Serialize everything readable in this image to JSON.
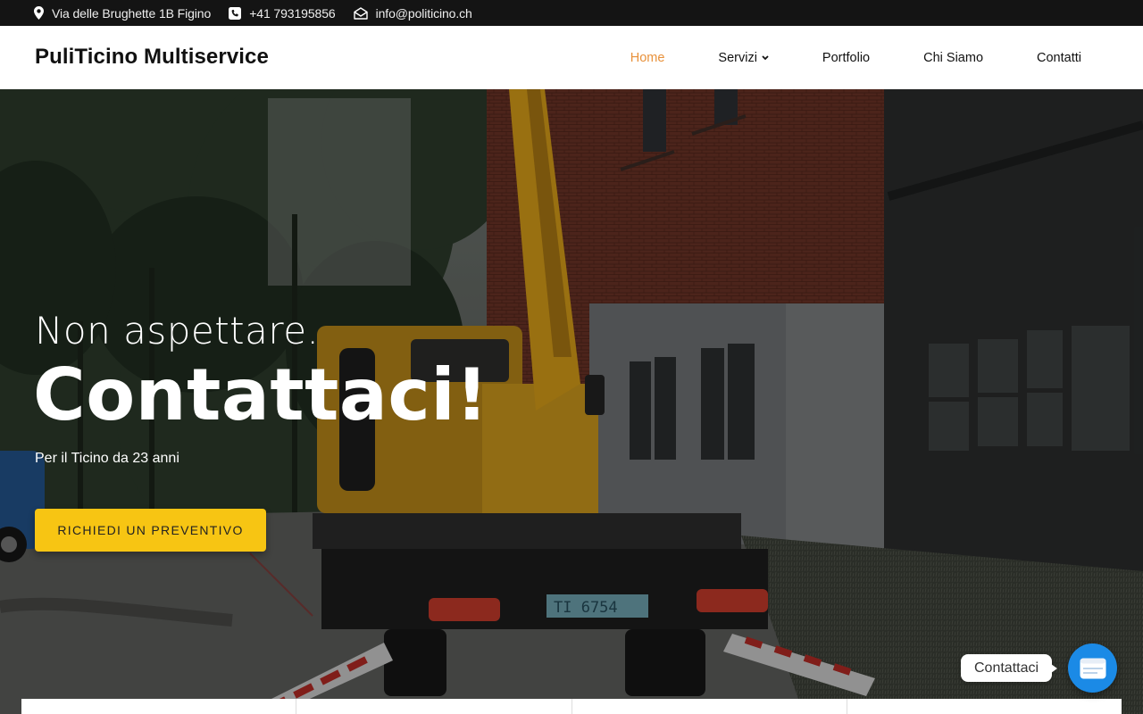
{
  "topbar": {
    "address": "Via delle Brughette 1B Figino",
    "phone": "+41 793195856",
    "email": "info@politicino.ch",
    "icons": [
      "map-pin-icon",
      "phone-icon",
      "envelope-icon"
    ]
  },
  "header": {
    "brand": "PuliTicino Multiservice",
    "nav": [
      {
        "label": "Home",
        "active": true
      },
      {
        "label": "Servizi",
        "has_dropdown": true
      },
      {
        "label": "Portfolio"
      },
      {
        "label": "Chi Siamo"
      },
      {
        "label": "Contatti"
      }
    ]
  },
  "hero": {
    "subtitle": "Non aspettare.",
    "title": "Contattaci!",
    "tagline": "Per il Ticino da 23 anni",
    "cta": "RICHIEDI UN PREVENTIVO",
    "plate": "TI 6754"
  },
  "chat": {
    "label": "Contattaci"
  },
  "colors": {
    "accent": "#e8913b",
    "button": "#f7c513",
    "chat": "#1b8ae6"
  }
}
